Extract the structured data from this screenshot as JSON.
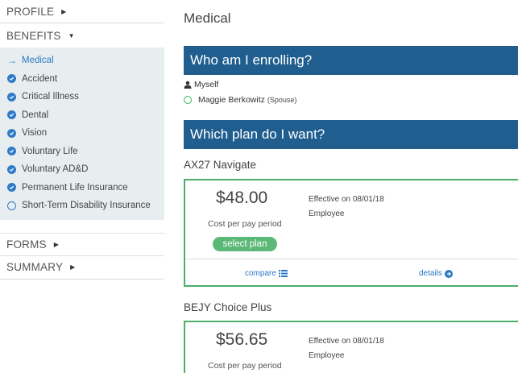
{
  "sidebar": {
    "profile": "PROFILE",
    "benefits": "BENEFITS",
    "forms": "FORMS",
    "summary": "SUMMARY",
    "benefit_items": [
      {
        "label": "Medical",
        "state": "current"
      },
      {
        "label": "Accident",
        "state": "complete"
      },
      {
        "label": "Critical Illness",
        "state": "complete"
      },
      {
        "label": "Dental",
        "state": "complete"
      },
      {
        "label": "Vision",
        "state": "complete"
      },
      {
        "label": "Voluntary Life",
        "state": "complete"
      },
      {
        "label": "Voluntary AD&D",
        "state": "complete"
      },
      {
        "label": "Permanent Life Insurance",
        "state": "complete"
      },
      {
        "label": "Short-Term Disability Insurance",
        "state": "incomplete"
      }
    ],
    "icons": {
      "collapsed": "triangle-right-icon",
      "expanded": "triangle-down-icon"
    }
  },
  "main": {
    "title": "Medical",
    "enroll_section": {
      "heading": "Who am I enrolling?",
      "self_label": "Myself",
      "spouse_name": "Maggie Berkowitz",
      "spouse_relation": "(Spouse)"
    },
    "plan_section": {
      "heading": "Which plan do I want?",
      "plans": [
        {
          "name": "AX27 Navigate",
          "price": "$48.00",
          "cost_label": "Cost per pay period",
          "effective": "Effective on 08/01/18",
          "coverage": "Employee",
          "select_label": "select plan",
          "compare_label": "compare",
          "details_label": "details"
        },
        {
          "name": "BEJY Choice Plus",
          "price": "$56.65",
          "cost_label": "Cost per pay period",
          "effective": "Effective on 08/01/18",
          "coverage": "Employee"
        }
      ]
    }
  },
  "colors": {
    "section_bar": "#1f5e8f",
    "accent_blue": "#2a78c4",
    "plan_border": "#4cae6a",
    "select_button": "#5cb877",
    "sidebar_bg": "#e8eef0"
  }
}
